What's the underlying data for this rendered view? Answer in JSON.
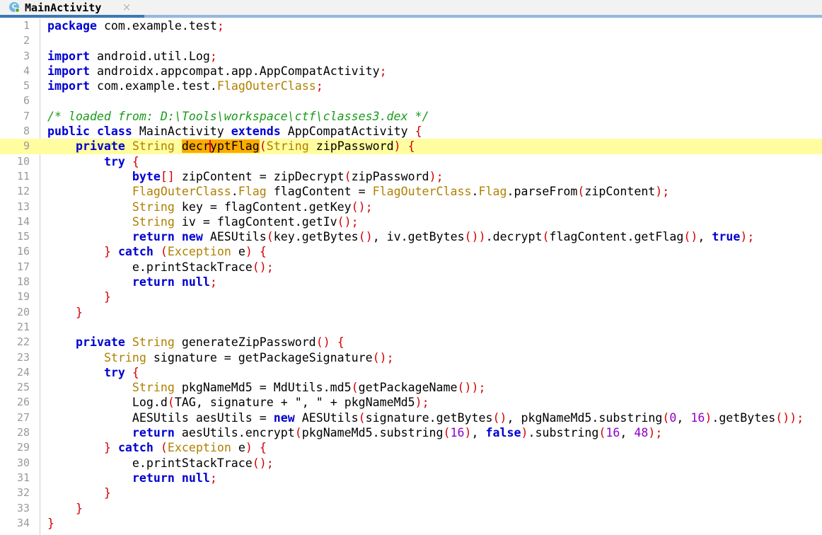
{
  "window": {
    "title": "MainActivity"
  },
  "tab": {
    "label": "MainActivity",
    "icon": "java-class-icon",
    "icon_letter": "C",
    "close_label": "×",
    "active": true
  },
  "colors": {
    "keyword": "#0000d0",
    "type": "#b08000",
    "punctuation": "#d40000",
    "number": "#9000c8",
    "comment": "#1a9b1a",
    "plain": "#000000",
    "line_highlight": "#fffda0",
    "search_match": "#ffab00",
    "caret": "#ff0000",
    "gutter_text": "#9a9a9a",
    "tab_active_underline": "#3c78b4",
    "tab_underline_track": "#94b8dd",
    "tab_background": "#f2f2f2"
  },
  "editor": {
    "highlighted_line": 9,
    "caret_line": 9,
    "caret_column": 26,
    "search_match_text": "decryptFlag",
    "total_lines": 34,
    "lines": [
      {
        "n": "1",
        "text": "package com.example.test;"
      },
      {
        "n": "2",
        "text": ""
      },
      {
        "n": "3",
        "text": "import android.util.Log;"
      },
      {
        "n": "4",
        "text": "import androidx.appcompat.app.AppCompatActivity;"
      },
      {
        "n": "5",
        "text": "import com.example.test.FlagOuterClass;"
      },
      {
        "n": "6",
        "text": ""
      },
      {
        "n": "7",
        "text": "/* loaded from: D:\\Tools\\workspace\\ctf\\classes3.dex */"
      },
      {
        "n": "8",
        "text": "public class MainActivity extends AppCompatActivity {"
      },
      {
        "n": "9",
        "text": "    private String decryptFlag(String zipPassword) {"
      },
      {
        "n": "10",
        "text": "        try {"
      },
      {
        "n": "11",
        "text": "            byte[] zipContent = zipDecrypt(zipPassword);"
      },
      {
        "n": "12",
        "text": "            FlagOuterClass.Flag flagContent = FlagOuterClass.Flag.parseFrom(zipContent);"
      },
      {
        "n": "13",
        "text": "            String key = flagContent.getKey();"
      },
      {
        "n": "14",
        "text": "            String iv = flagContent.getIv();"
      },
      {
        "n": "15",
        "text": "            return new AESUtils(key.getBytes(), iv.getBytes()).decrypt(flagContent.getFlag(), true);"
      },
      {
        "n": "16",
        "text": "        } catch (Exception e) {"
      },
      {
        "n": "17",
        "text": "            e.printStackTrace();"
      },
      {
        "n": "18",
        "text": "            return null;"
      },
      {
        "n": "19",
        "text": "        }"
      },
      {
        "n": "20",
        "text": "    }"
      },
      {
        "n": "21",
        "text": ""
      },
      {
        "n": "22",
        "text": "    private String generateZipPassword() {"
      },
      {
        "n": "23",
        "text": "        String signature = getPackageSignature();"
      },
      {
        "n": "24",
        "text": "        try {"
      },
      {
        "n": "25",
        "text": "            String pkgNameMd5 = MdUtils.md5(getPackageName());"
      },
      {
        "n": "26",
        "text": "            Log.d(TAG, signature + \", \" + pkgNameMd5);"
      },
      {
        "n": "27",
        "text": "            AESUtils aesUtils = new AESUtils(signature.getBytes(), pkgNameMd5.substring(0, 16).getBytes());"
      },
      {
        "n": "28",
        "text": "            return aesUtils.encrypt(pkgNameMd5.substring(16), false).substring(16, 48);"
      },
      {
        "n": "29",
        "text": "        } catch (Exception e) {"
      },
      {
        "n": "30",
        "text": "            e.printStackTrace();"
      },
      {
        "n": "31",
        "text": "            return null;"
      },
      {
        "n": "32",
        "text": "        }"
      },
      {
        "n": "33",
        "text": "    }"
      },
      {
        "n": "34",
        "text": "}"
      }
    ]
  }
}
